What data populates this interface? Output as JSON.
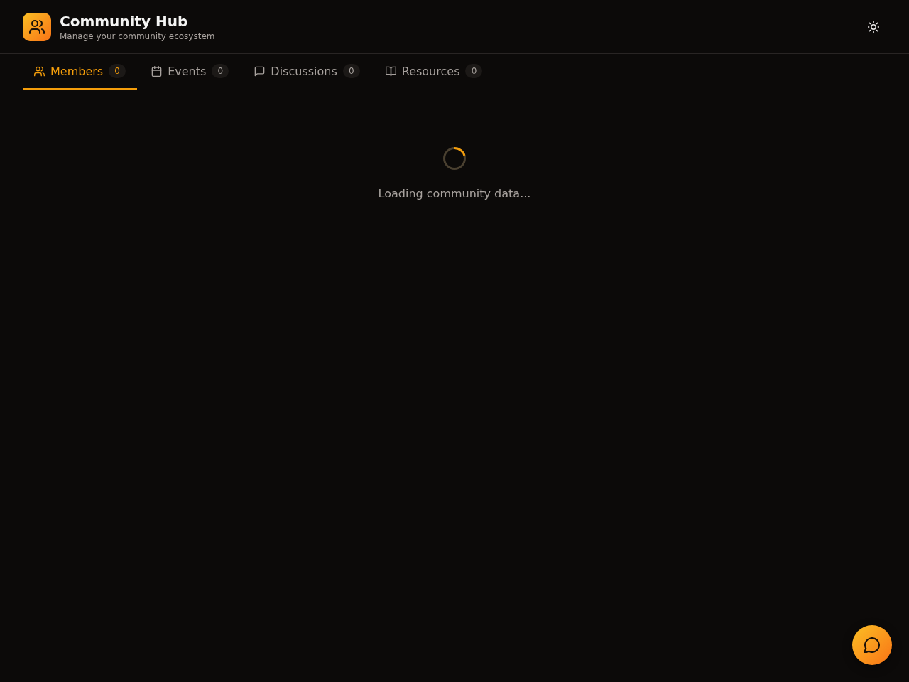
{
  "header": {
    "title": "Community Hub",
    "subtitle": "Manage your community ecosystem"
  },
  "tabs": [
    {
      "label": "Members",
      "count": "0",
      "selected": true
    },
    {
      "label": "Events",
      "count": "0",
      "selected": false
    },
    {
      "label": "Discussions",
      "count": "0",
      "selected": false
    },
    {
      "label": "Resources",
      "count": "0",
      "selected": false
    }
  ],
  "loading": {
    "message": "Loading community data..."
  }
}
